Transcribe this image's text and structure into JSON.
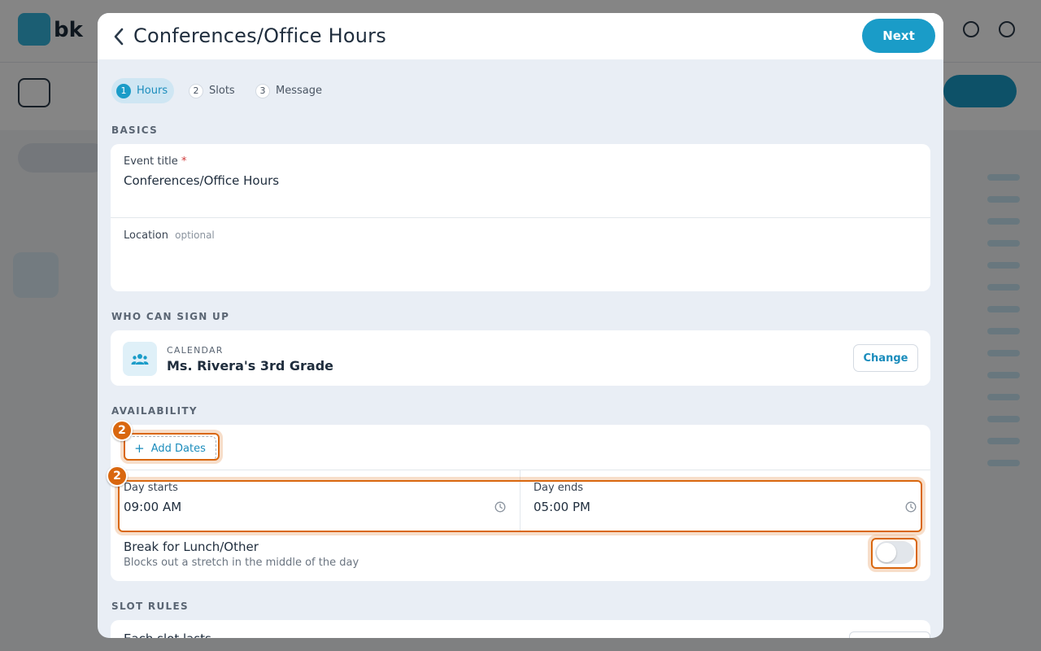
{
  "background": {
    "logo_text": "bk"
  },
  "modal": {
    "title": "Conferences/Office Hours",
    "next_label": "Next"
  },
  "steps": [
    {
      "num": "1",
      "label": "Hours"
    },
    {
      "num": "2",
      "label": "Slots"
    },
    {
      "num": "3",
      "label": "Message"
    }
  ],
  "basics": {
    "section": "BASICS",
    "event_title_label": "Event title",
    "required_mark": "*",
    "event_title_value": "Conferences/Office Hours",
    "location_label": "Location",
    "location_optional": "optional"
  },
  "who": {
    "section": "WHO CAN SIGN UP",
    "kicker": "CALENDAR",
    "calendar_name": "Ms. Rivera's 3rd Grade",
    "change_label": "Change"
  },
  "availability": {
    "section": "AVAILABILITY",
    "add_dates_label": "Add Dates",
    "day_starts_label": "Day starts",
    "day_starts_value": "09:00 AM",
    "day_ends_label": "Day ends",
    "day_ends_value": "05:00 PM",
    "break_title": "Break for Lunch/Other",
    "break_sub": "Blocks out a stretch in the middle of the day",
    "break_enabled": false
  },
  "slot_rules": {
    "section": "SLOT RULES",
    "each_slot_label": "Each slot lasts"
  },
  "annotations": {
    "badge_1": "2",
    "badge_2": "2"
  },
  "colors": {
    "accent": "#1a9cc8",
    "highlight": "#d9670f"
  }
}
